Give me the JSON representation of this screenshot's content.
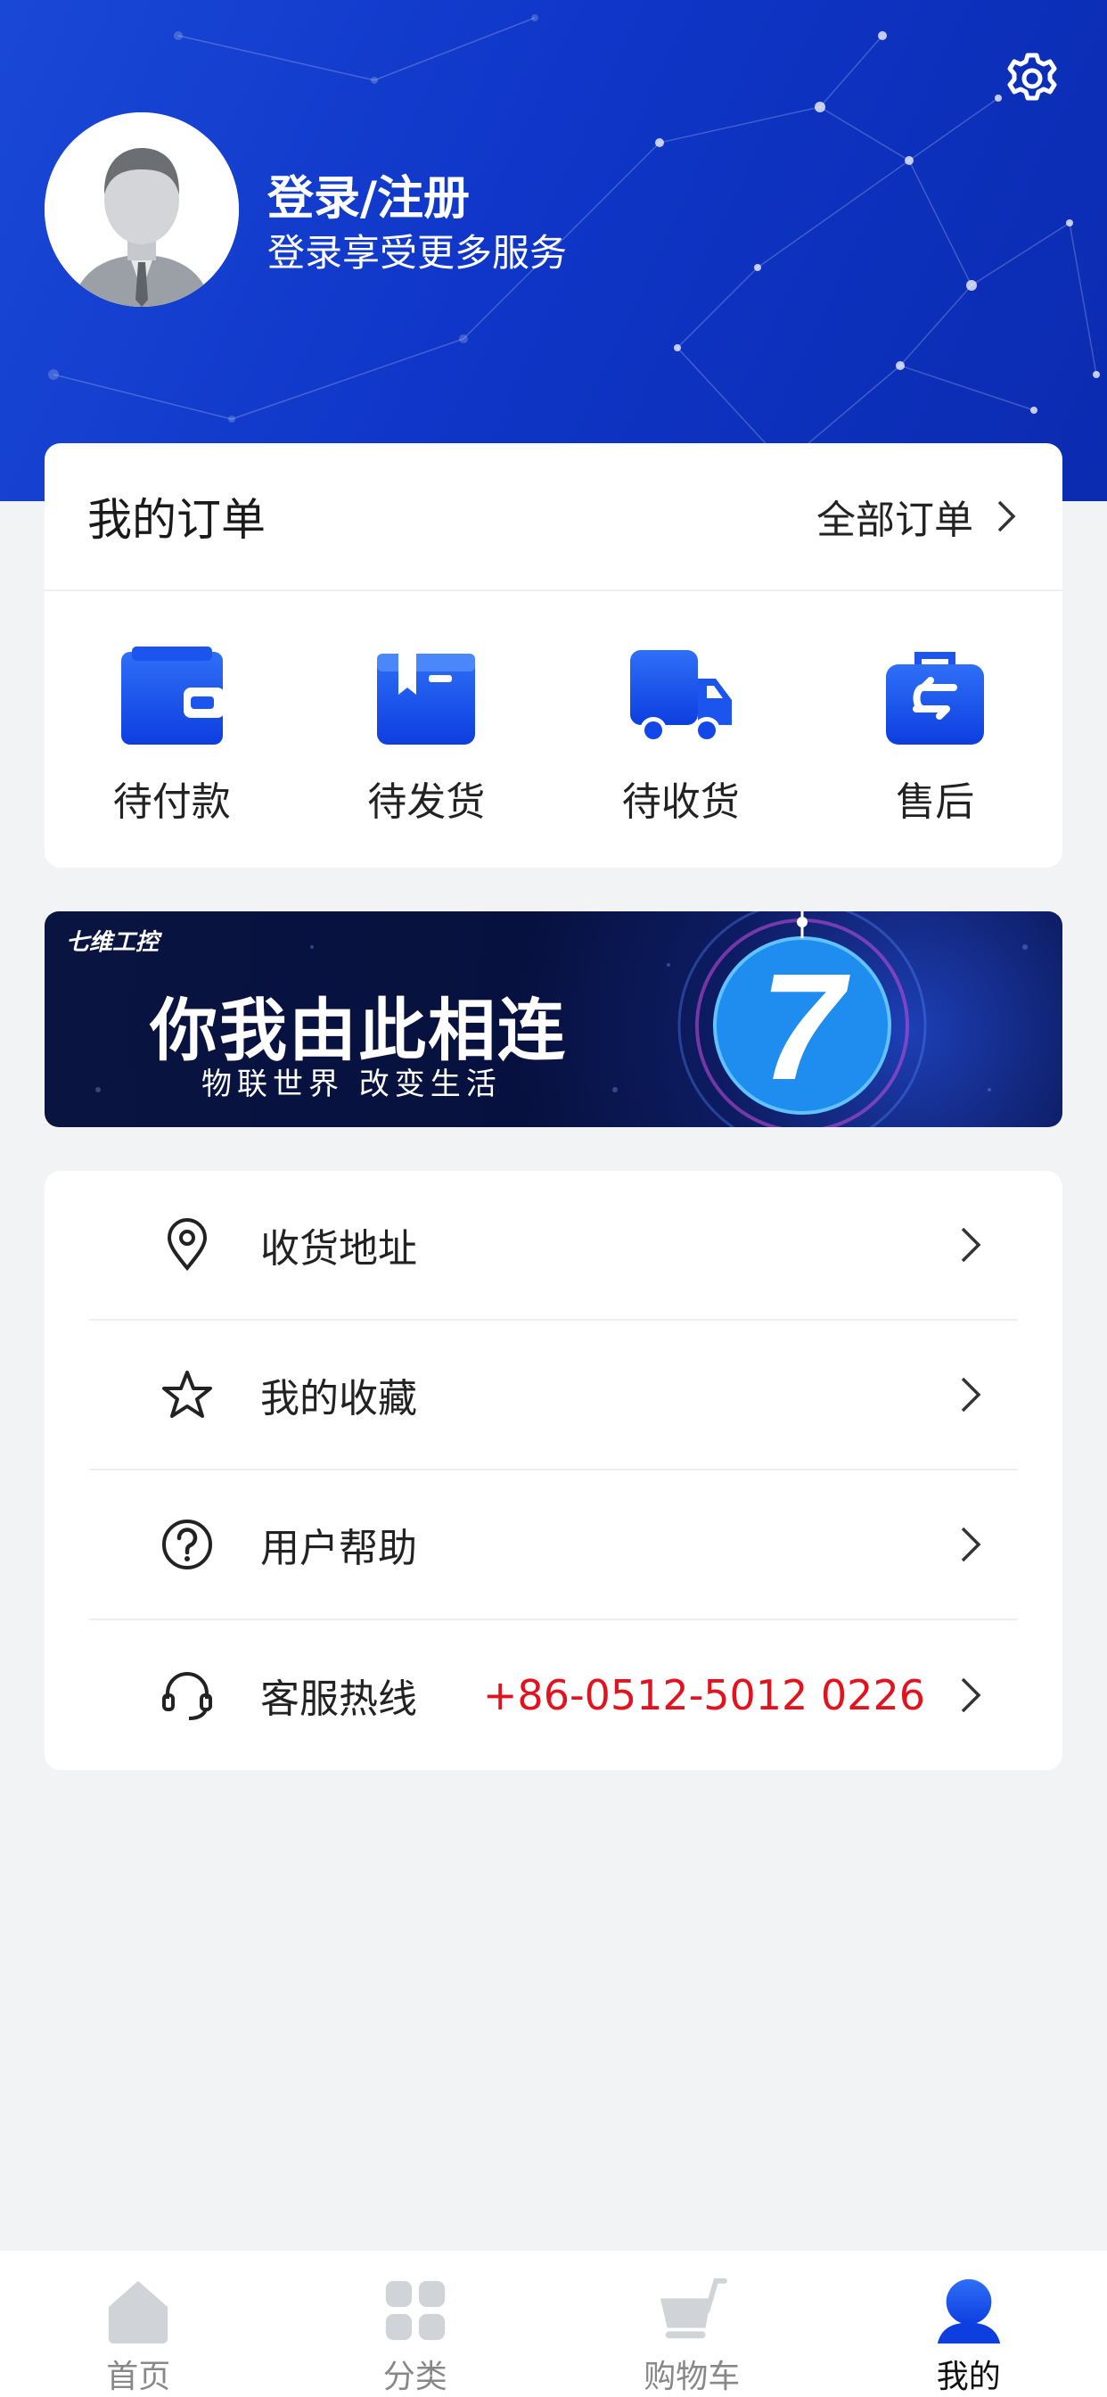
{
  "header": {
    "login_title": "登录/注册",
    "login_subtitle": "登录享受更多服务",
    "settings_icon": "gear-icon",
    "avatar_icon": "default-avatar"
  },
  "orders": {
    "title": "我的订单",
    "all_label": "全部订单",
    "items": [
      {
        "label": "待付款",
        "icon": "wallet-icon"
      },
      {
        "label": "待发货",
        "icon": "box-icon"
      },
      {
        "label": "待收货",
        "icon": "truck-icon"
      },
      {
        "label": "售后",
        "icon": "after-sales-bag-icon"
      }
    ]
  },
  "banner": {
    "brand": "七维工控",
    "slogan": "你我由此相连",
    "subtitle": "物联世界 改变生活",
    "logo_text": "7"
  },
  "menu": {
    "items": [
      {
        "label": "收货地址",
        "icon": "location-pin-icon"
      },
      {
        "label": "我的收藏",
        "icon": "star-icon"
      },
      {
        "label": "用户帮助",
        "icon": "help-circle-icon"
      },
      {
        "label": "客服热线",
        "icon": "headset-icon",
        "value": "+86-0512-5012 0226"
      }
    ]
  },
  "tabbar": {
    "tabs": [
      {
        "label": "首页",
        "icon": "home-icon",
        "active": false
      },
      {
        "label": "分类",
        "icon": "category-icon",
        "active": false
      },
      {
        "label": "购物车",
        "icon": "cart-icon",
        "active": false
      },
      {
        "label": "我的",
        "icon": "user-icon",
        "active": true
      }
    ]
  },
  "colors": {
    "accent": "#1351e8",
    "header_blue": "#0f36c8",
    "phone_red": "#e2131f",
    "background": "#f2f3f5"
  }
}
